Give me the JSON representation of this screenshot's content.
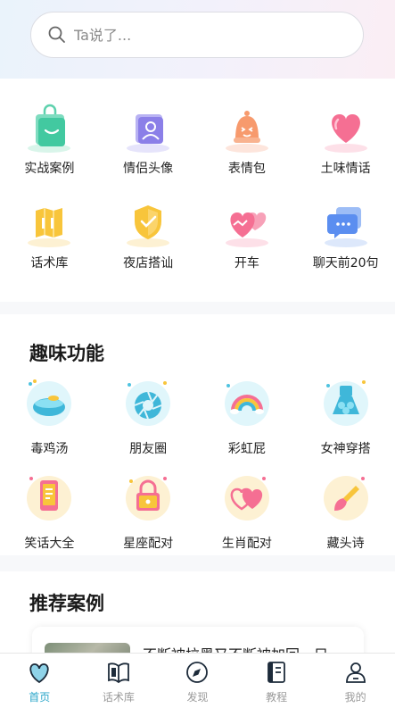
{
  "search": {
    "placeholder": "Ta说了..."
  },
  "main_grid": [
    {
      "label": "实战案例",
      "icon": "shopping-bag-icon"
    },
    {
      "label": "情侣头像",
      "icon": "portrait-icon"
    },
    {
      "label": "表情包",
      "icon": "bell-face-icon"
    },
    {
      "label": "土味情话",
      "icon": "heart-icon"
    },
    {
      "label": "话术库",
      "icon": "book-icon"
    },
    {
      "label": "夜店搭讪",
      "icon": "shield-check-icon"
    },
    {
      "label": "开车",
      "icon": "double-heart-icon"
    },
    {
      "label": "聊天前20句",
      "icon": "chat-bubble-icon"
    }
  ],
  "fun_section": {
    "title": "趣味功能",
    "items": [
      {
        "label": "毒鸡汤",
        "icon": "soup-bowl-icon"
      },
      {
        "label": "朋友圈",
        "icon": "aperture-icon"
      },
      {
        "label": "彩虹屁",
        "icon": "rainbow-icon"
      },
      {
        "label": "女神穿搭",
        "icon": "dress-icon"
      },
      {
        "label": "笑话大全",
        "icon": "phone-icon"
      },
      {
        "label": "星座配对",
        "icon": "lock-icon"
      },
      {
        "label": "生肖配对",
        "icon": "hearts-pair-icon"
      },
      {
        "label": "藏头诗",
        "icon": "brush-icon"
      }
    ]
  },
  "recommend_section": {
    "title": "推荐案例",
    "case_title": "不断被拉黑又不断被加回，只"
  },
  "tabbar": [
    {
      "label": "首页",
      "icon": "home-heart-icon",
      "active": true
    },
    {
      "label": "话术库",
      "icon": "open-book-icon",
      "active": false
    },
    {
      "label": "发现",
      "icon": "compass-icon",
      "active": false
    },
    {
      "label": "教程",
      "icon": "notebook-icon",
      "active": false
    },
    {
      "label": "我的",
      "icon": "profile-icon",
      "active": false
    }
  ],
  "colors": {
    "accent": "#2aa6c9",
    "tab_inactive": "#9a9a9a"
  }
}
